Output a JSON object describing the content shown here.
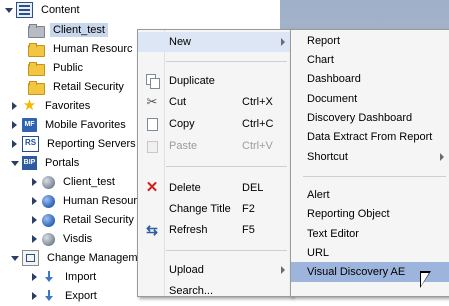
{
  "tree": {
    "items": [
      {
        "label": "Content",
        "icon": "content-icon"
      },
      {
        "label": "Client_test",
        "icon": "folder-icon"
      },
      {
        "label": "Human Resourc",
        "icon": "folder-icon"
      },
      {
        "label": "Public",
        "icon": "folder-icon"
      },
      {
        "label": "Retail Security",
        "icon": "folder-icon"
      },
      {
        "label": "Favorites",
        "icon": "star-icon"
      },
      {
        "label": "Mobile Favorites",
        "icon": "mobile-favorites-icon",
        "badge": "MF"
      },
      {
        "label": "Reporting Servers",
        "icon": "reporting-servers-icon",
        "badge": "RS"
      },
      {
        "label": "Portals",
        "icon": "portals-icon",
        "badge": "BIP"
      },
      {
        "label": "Client_test",
        "icon": "globe-icon"
      },
      {
        "label": "Human Resourc",
        "icon": "globe-icon"
      },
      {
        "label": "Retail Security",
        "icon": "globe-icon"
      },
      {
        "label": "Visdis",
        "icon": "globe-icon"
      },
      {
        "label": "Change Manageme",
        "icon": "change-management-icon"
      },
      {
        "label": "Import",
        "icon": "import-icon"
      },
      {
        "label": "Export",
        "icon": "export-icon"
      }
    ]
  },
  "context_menu": {
    "items": [
      {
        "label": "New",
        "shortcut": "",
        "icon": ""
      },
      {
        "label": "Duplicate",
        "shortcut": "",
        "icon": "duplicate-icon"
      },
      {
        "label": "Cut",
        "shortcut": "Ctrl+X",
        "icon": "cut-icon"
      },
      {
        "label": "Copy",
        "shortcut": "Ctrl+C",
        "icon": "copy-icon"
      },
      {
        "label": "Paste",
        "shortcut": "Ctrl+V",
        "icon": "paste-icon"
      },
      {
        "label": "Delete",
        "shortcut": "DEL",
        "icon": "delete-icon"
      },
      {
        "label": "Change Title",
        "shortcut": "F2",
        "icon": ""
      },
      {
        "label": "Refresh",
        "shortcut": "F5",
        "icon": "refresh-icon"
      },
      {
        "label": "Upload",
        "shortcut": "",
        "icon": ""
      },
      {
        "label": "Search...",
        "shortcut": "",
        "icon": ""
      }
    ]
  },
  "submenu": {
    "items": [
      {
        "label": "Report"
      },
      {
        "label": "Chart"
      },
      {
        "label": "Dashboard"
      },
      {
        "label": "Document"
      },
      {
        "label": "Discovery Dashboard"
      },
      {
        "label": "Data Extract From Report"
      },
      {
        "label": "Shortcut"
      },
      {
        "label": "Alert"
      },
      {
        "label": "Reporting Object"
      },
      {
        "label": "Text Editor"
      },
      {
        "label": "URL"
      },
      {
        "label": "Visual Discovery AE"
      }
    ]
  },
  "colors": {
    "highlight": "#9db4dd",
    "selected": "#c9d7ec",
    "delete_icon": "#d0221b"
  }
}
